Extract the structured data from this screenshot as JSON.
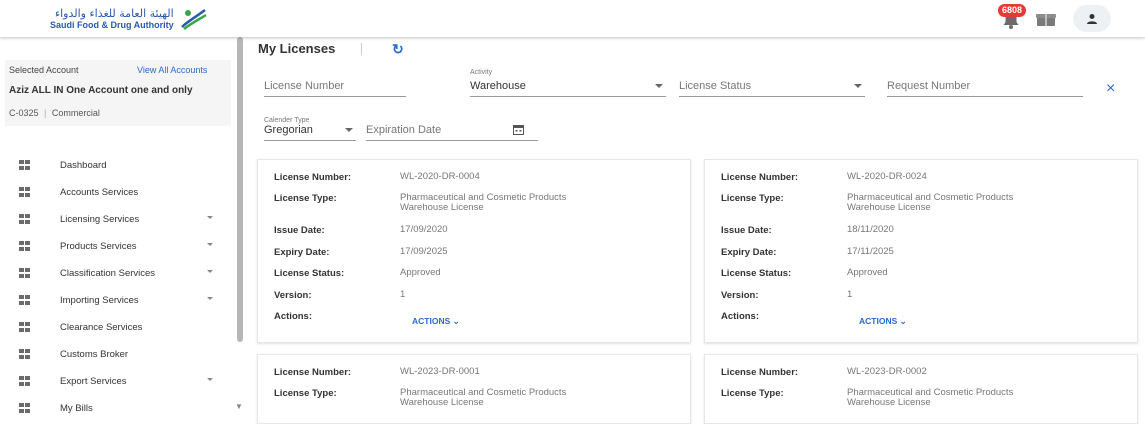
{
  "header": {
    "logo_arabic": "الهيئة العامة للغذاء والدواء",
    "logo_english": "Saudi Food & Drug Authority",
    "notification_count": "6808",
    "brand_color": "#2a6bd1"
  },
  "sidebar": {
    "account": {
      "selected_label": "Selected Account",
      "view_all": "View All Accounts",
      "name": "Aziz ALL IN One Account one and only",
      "code": "C-0325",
      "separator": "|",
      "type": "Commercial"
    },
    "items": [
      {
        "label": "Dashboard",
        "has_submenu": false
      },
      {
        "label": "Accounts Services",
        "has_submenu": false
      },
      {
        "label": "Licensing Services",
        "has_submenu": true
      },
      {
        "label": "Products Services",
        "has_submenu": true
      },
      {
        "label": "Classification Services",
        "has_submenu": true
      },
      {
        "label": "Importing Services",
        "has_submenu": true
      },
      {
        "label": "Clearance Services",
        "has_submenu": false
      },
      {
        "label": "Customs Broker",
        "has_submenu": false
      },
      {
        "label": "Export Services",
        "has_submenu": true
      },
      {
        "label": "My Bills",
        "has_submenu": false
      }
    ]
  },
  "main": {
    "title": "My Licenses",
    "filters": {
      "license_number_placeholder": "License Number",
      "activity_label": "Activity",
      "activity_value": "Warehouse",
      "license_status_placeholder": "License Status",
      "request_number_placeholder": "Request Number",
      "calendar_type_label": "Calender Type",
      "calendar_type_value": "Gregorian",
      "expiration_date_placeholder": "Expiration Date",
      "clear_icon": "×"
    },
    "labels": {
      "license_number": "License Number:",
      "license_type": "License Type:",
      "issue_date": "Issue Date:",
      "expiry_date": "Expiry Date:",
      "license_status": "License Status:",
      "version": "Version:",
      "actions": "Actions:",
      "actions_button": "ACTIONS"
    },
    "cards": [
      {
        "license_number": "WL-2020-DR-0004",
        "license_type_1": "Pharmaceutical and Cosmetic Products",
        "license_type_2": "Warehouse License",
        "issue_date": "17/09/2020",
        "expiry_date": "17/09/2025",
        "status": "Approved",
        "version": "1"
      },
      {
        "license_number": "WL-2020-DR-0024",
        "license_type_1": "Pharmaceutical and Cosmetic Products",
        "license_type_2": "Warehouse License",
        "issue_date": "18/11/2020",
        "expiry_date": "17/11/2025",
        "status": "Approved",
        "version": "1"
      },
      {
        "license_number": "WL-2023-DR-0001",
        "license_type_1": "Pharmaceutical and Cosmetic Products",
        "license_type_2": "Warehouse License"
      },
      {
        "license_number": "WL-2023-DR-0002",
        "license_type_1": "Pharmaceutical and Cosmetic Products",
        "license_type_2": "Warehouse License"
      }
    ]
  }
}
